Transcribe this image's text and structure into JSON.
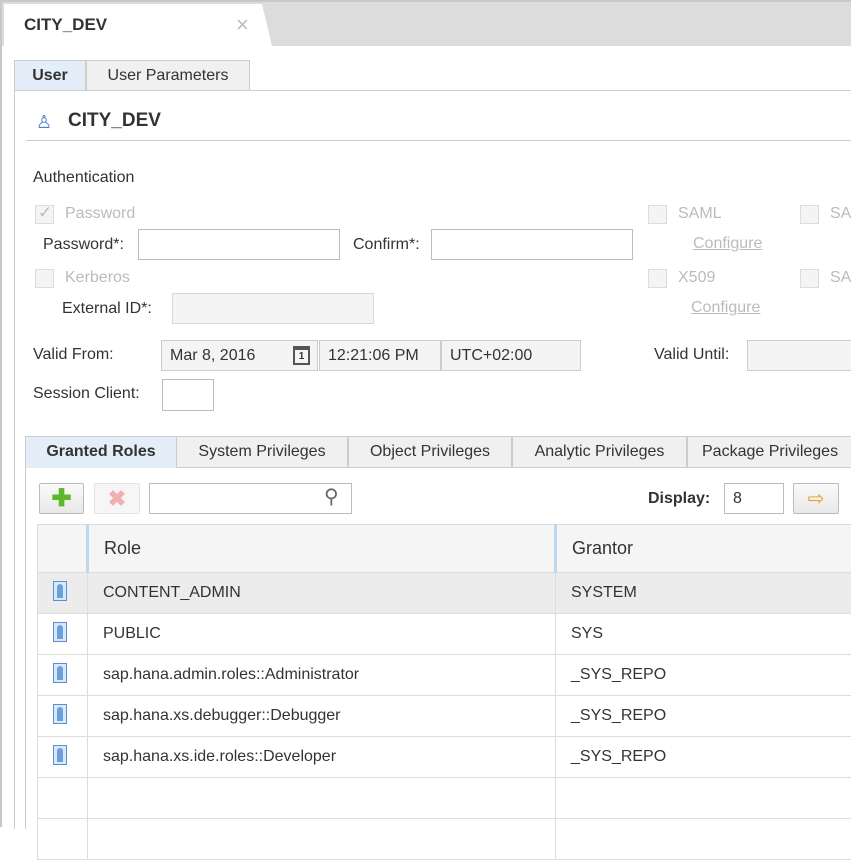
{
  "doc_tab": {
    "title": "CITY_DEV",
    "close": "×"
  },
  "user_tabs": [
    "User",
    "User Parameters"
  ],
  "header": {
    "title": "CITY_DEV"
  },
  "auth": {
    "section": "Authentication",
    "password_option": "Password",
    "password_label": "Password*:",
    "password_value": "",
    "confirm_label": "Confirm*:",
    "confirm_value": "",
    "kerberos_option": "Kerberos",
    "external_id_label": "External ID*:",
    "external_id_value": "",
    "saml_option": "SAML",
    "saml_configure": "Configure",
    "x509_option": "X509",
    "x509_configure": "Configure",
    "sap1_option": "SA",
    "sap2_option": "SA"
  },
  "validity": {
    "valid_from_label": "Valid From:",
    "date": "Mar 8, 2016",
    "calendar_day": "1",
    "time": "12:21:06 PM",
    "timezone": "UTC+02:00",
    "valid_until_label": "Valid Until:",
    "valid_until_value": "",
    "session_client_label": "Session Client:",
    "session_client_value": ""
  },
  "role_tabs": [
    "Granted Roles",
    "System Privileges",
    "Object Privileges",
    "Analytic Privileges",
    "Package Privileges"
  ],
  "toolbar": {
    "search_value": "",
    "display_label": "Display:",
    "display_value": "8"
  },
  "table": {
    "headers": [
      "Role",
      "Grantor"
    ],
    "rows": [
      [
        "CONTENT_ADMIN",
        "SYSTEM"
      ],
      [
        "PUBLIC",
        "SYS"
      ],
      [
        "sap.hana.admin.roles::Administrator",
        "_SYS_REPO"
      ],
      [
        "sap.hana.xs.debugger::Debugger",
        "_SYS_REPO"
      ],
      [
        "sap.hana.xs.ide.roles::Developer",
        "_SYS_REPO"
      ]
    ]
  }
}
